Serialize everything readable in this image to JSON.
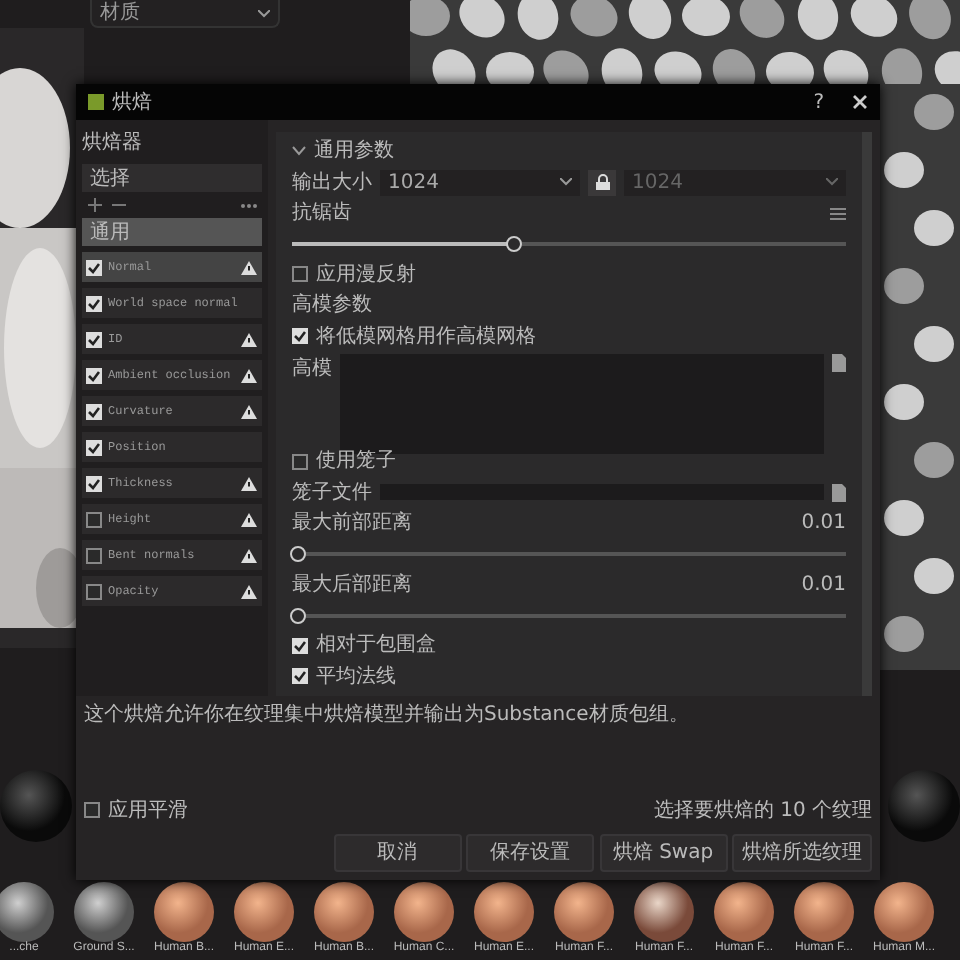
{
  "background": {
    "filter_dropdown": {
      "value": "材质"
    },
    "materials": [
      {
        "label": "...che"
      },
      {
        "label": "Ground S..."
      },
      {
        "label": "Human B..."
      },
      {
        "label": "Human E..."
      },
      {
        "label": "Human B..."
      },
      {
        "label": "Human C..."
      },
      {
        "label": "Human E..."
      },
      {
        "label": "Human F..."
      },
      {
        "label": "Human F..."
      },
      {
        "label": "Human F..."
      },
      {
        "label": "Human F..."
      },
      {
        "label": "Human M..."
      }
    ]
  },
  "dialog": {
    "title": "烘焙",
    "help": "?",
    "left": {
      "heading": "烘焙器",
      "preset": "选择",
      "list_header": "通用",
      "bakers": [
        {
          "name": "Normal",
          "checked": true,
          "selected": true,
          "warning": true
        },
        {
          "name": "World space normal",
          "checked": true,
          "selected": false,
          "warning": false
        },
        {
          "name": "ID",
          "checked": true,
          "selected": false,
          "warning": true
        },
        {
          "name": "Ambient occlusion",
          "checked": true,
          "selected": false,
          "warning": true
        },
        {
          "name": "Curvature",
          "checked": true,
          "selected": false,
          "warning": true
        },
        {
          "name": "Position",
          "checked": true,
          "selected": false,
          "warning": false
        },
        {
          "name": "Thickness",
          "checked": true,
          "selected": false,
          "warning": true
        },
        {
          "name": "Height",
          "checked": false,
          "selected": false,
          "warning": true
        },
        {
          "name": "Bent normals",
          "checked": false,
          "selected": false,
          "warning": true
        },
        {
          "name": "Opacity",
          "checked": false,
          "selected": false,
          "warning": true
        }
      ]
    },
    "section": {
      "title": "通用参数",
      "expanded": true,
      "rows": [
        {
          "kind": "size",
          "label": "输出大小",
          "value": "1024",
          "linked_value": "1024",
          "locked": true
        },
        {
          "kind": "label",
          "label": "抗锯齿",
          "menu": true
        },
        {
          "kind": "slider",
          "level": 0.4
        },
        {
          "kind": "checkbox",
          "label": "应用漫反射",
          "checked": false
        },
        {
          "kind": "label",
          "label": "高模参数"
        },
        {
          "kind": "checkbox",
          "label": "将低模网格用作高模网格",
          "checked": true
        },
        {
          "kind": "textarea",
          "label": "高模"
        },
        {
          "kind": "checkbox",
          "label": "使用笼子",
          "checked": false
        },
        {
          "kind": "file",
          "label": "笼子文件"
        },
        {
          "kind": "value",
          "label": "最大前部距离",
          "value": "0.01"
        },
        {
          "kind": "slider",
          "level": 0.01
        },
        {
          "kind": "value",
          "label": "最大后部距离",
          "value": "0.01"
        },
        {
          "kind": "slider",
          "level": 0.01
        },
        {
          "kind": "checkbox",
          "label": "相对于包围盒",
          "checked": true
        },
        {
          "kind": "checkbox",
          "label": "平均法线",
          "checked": true
        }
      ]
    },
    "description": "这个烘焙允许你在纹理集中烘焙模型并输出为Substance材质包组。",
    "option": {
      "label": "应用平滑",
      "checked": false
    },
    "status": "选择要烘焙的 10 个纹理",
    "buttons": [
      "取消",
      "保存设置",
      "烘焙 Swap",
      "烘焙所选纹理"
    ]
  }
}
